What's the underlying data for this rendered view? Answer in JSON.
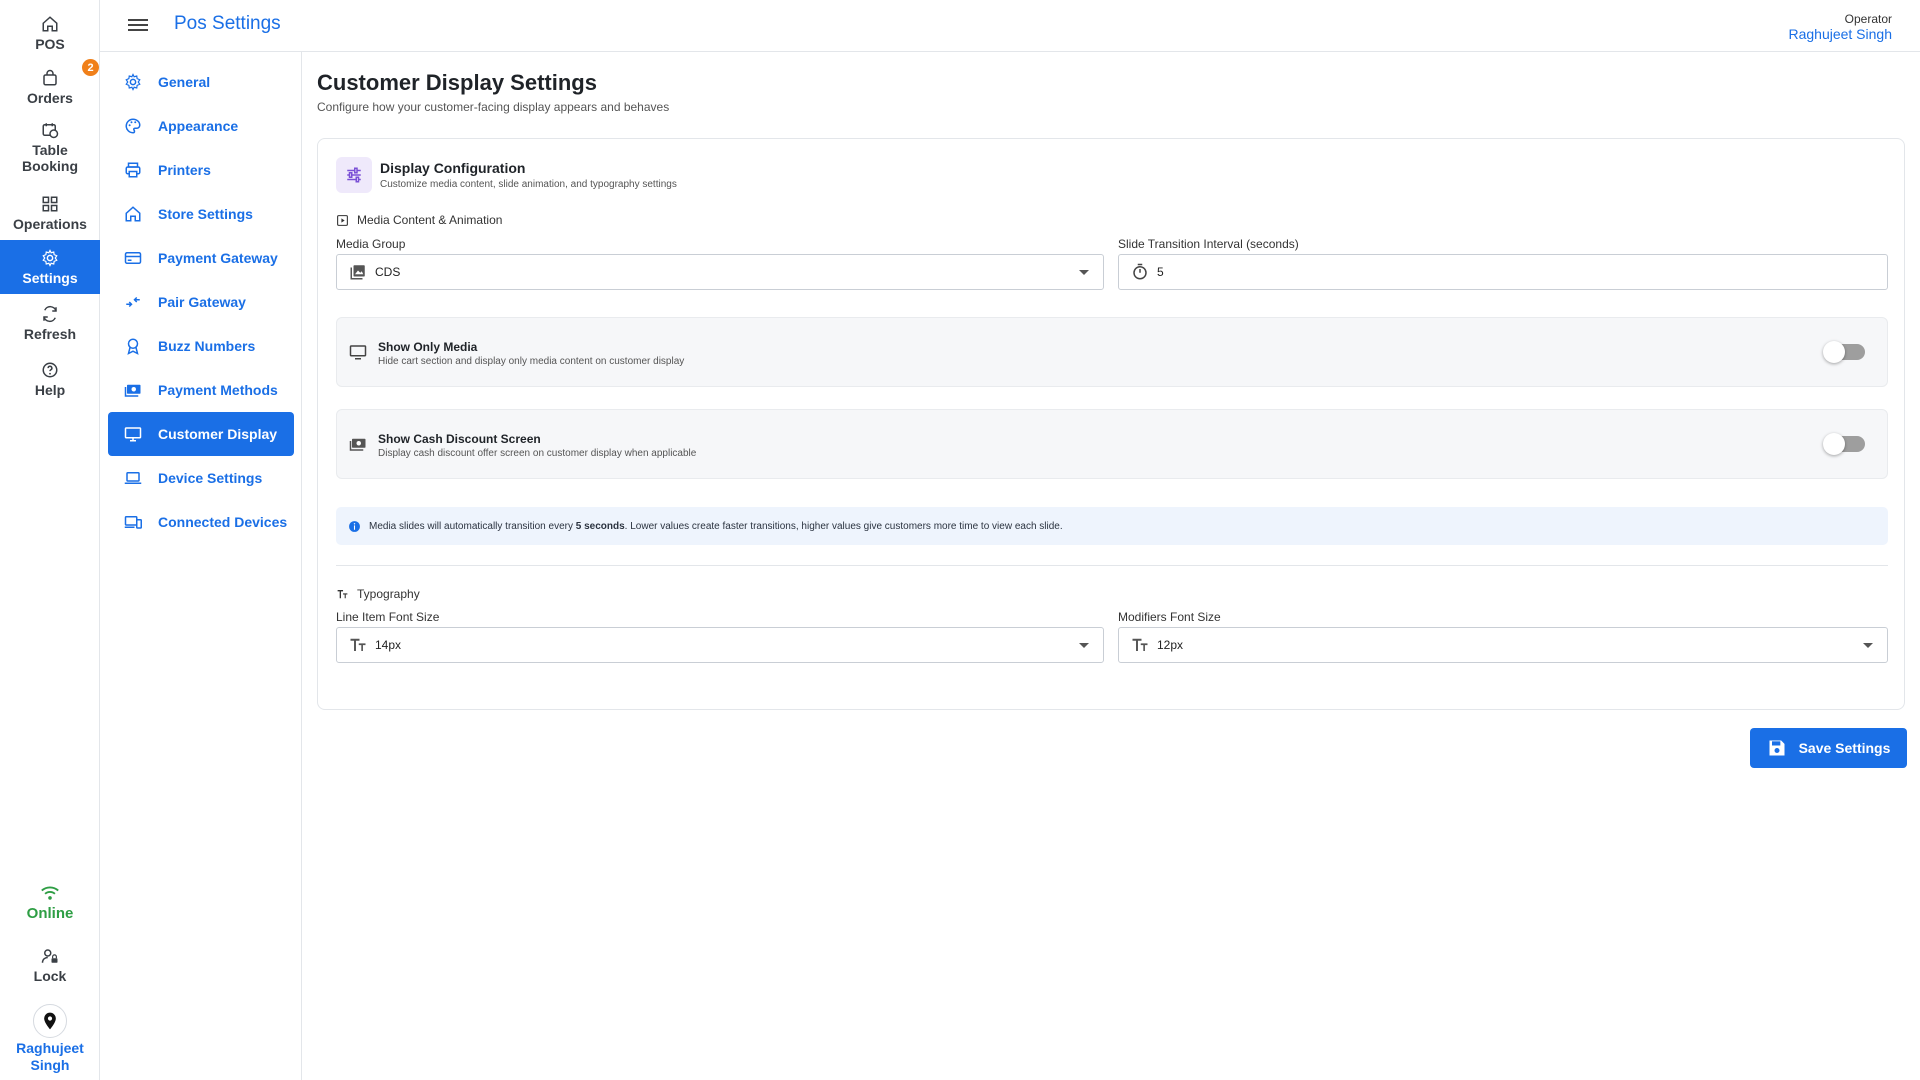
{
  "rail": {
    "items": [
      {
        "label": "POS",
        "icon": "home-icon"
      },
      {
        "label": "Orders",
        "icon": "bag-icon",
        "badge": "2"
      },
      {
        "label": "Table Booking",
        "icon": "calendar-clock-icon"
      },
      {
        "label": "Operations",
        "icon": "grid-icon"
      },
      {
        "label": "Settings",
        "icon": "gear-icon",
        "active": true
      },
      {
        "label": "Refresh",
        "icon": "refresh-icon"
      },
      {
        "label": "Help",
        "icon": "help-icon"
      }
    ],
    "status": "Online",
    "lock": "Lock",
    "user": "Raghujeet Singh"
  },
  "header": {
    "title": "Pos Settings",
    "operator_label": "Operator",
    "operator_name": "Raghujeet Singh"
  },
  "subnav": {
    "items": [
      {
        "label": "General",
        "icon": "gear-icon"
      },
      {
        "label": "Appearance",
        "icon": "palette-icon"
      },
      {
        "label": "Printers",
        "icon": "printer-icon"
      },
      {
        "label": "Store Settings",
        "icon": "store-icon"
      },
      {
        "label": "Payment Gateway",
        "icon": "card-icon"
      },
      {
        "label": "Pair Gateway",
        "icon": "pair-icon"
      },
      {
        "label": "Buzz Numbers",
        "icon": "badge-icon"
      },
      {
        "label": "Payment Methods",
        "icon": "cash-icon"
      },
      {
        "label": "Customer Display",
        "icon": "monitor-icon",
        "active": true
      },
      {
        "label": "Device Settings",
        "icon": "laptop-icon"
      },
      {
        "label": "Connected Devices",
        "icon": "devices-icon"
      }
    ]
  },
  "page": {
    "title": "Customer Display Settings",
    "subtitle": "Configure how your customer-facing display appears and behaves"
  },
  "card": {
    "title": "Display Configuration",
    "subtitle": "Customize media content, slide animation, and typography settings",
    "media_section": "Media Content & Animation",
    "media_group_label": "Media Group",
    "media_group_value": "CDS",
    "interval_label": "Slide Transition Interval (seconds)",
    "interval_value": "5",
    "toggles": [
      {
        "title": "Show Only Media",
        "subtitle": "Hide cart section and display only media content on customer display",
        "on": false
      },
      {
        "title": "Show Cash Discount Screen",
        "subtitle": "Display cash discount offer screen on customer display when applicable",
        "on": false
      }
    ],
    "info_pre": "Media slides will automatically transition every ",
    "info_bold": "5 seconds",
    "info_post": ". Lower values create faster transitions, higher values give customers more time to view each slide.",
    "typography_section": "Typography",
    "line_item_label": "Line Item Font Size",
    "line_item_value": "14px",
    "modifiers_label": "Modifiers Font Size",
    "modifiers_value": "12px"
  },
  "save_label": "Save Settings",
  "colors": {
    "accent": "#1a6fe6",
    "online": "#2e9e44",
    "badge": "#f0801a"
  }
}
